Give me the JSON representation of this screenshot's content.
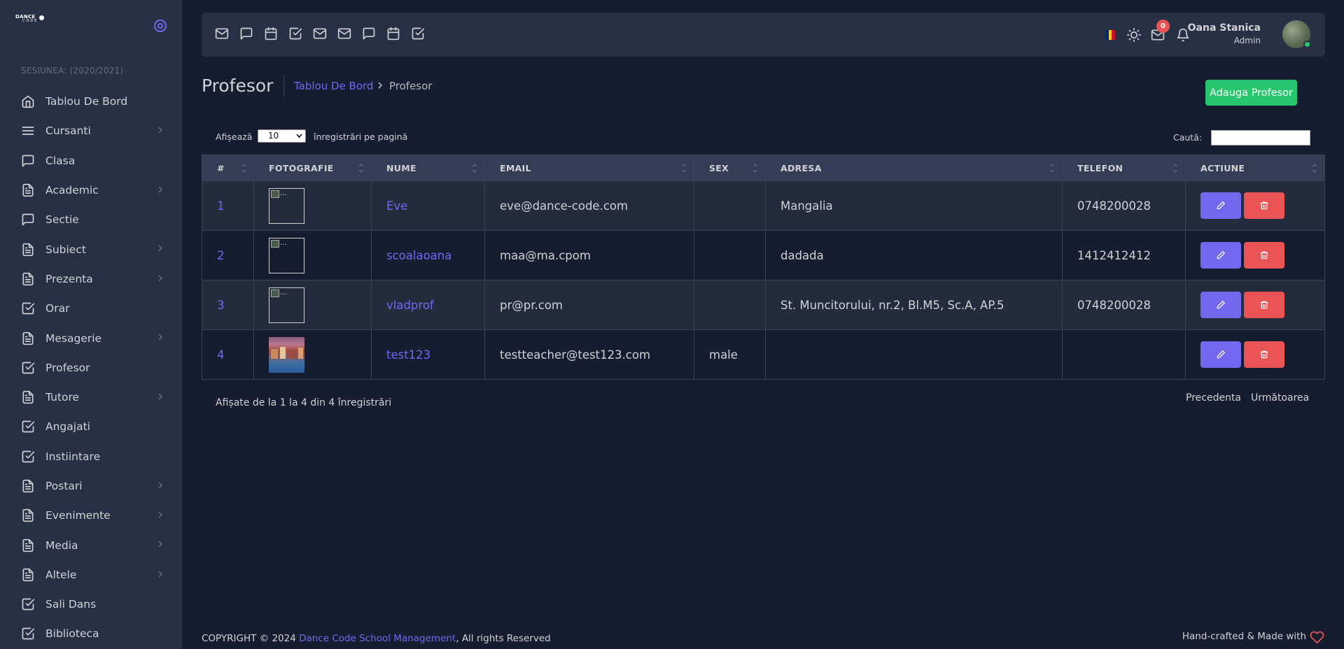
{
  "brand": {
    "logo_top": "DANCE",
    "logo_bottom": "CODE"
  },
  "sidebar": {
    "session": "SESIUNEA: (2020/2021)",
    "items": [
      {
        "label": "Tablou De Bord",
        "icon": "home-icon",
        "has_sub": false
      },
      {
        "label": "Cursanti",
        "icon": "menu-icon",
        "has_sub": true
      },
      {
        "label": "Clasa",
        "icon": "chat-icon",
        "has_sub": false
      },
      {
        "label": "Academic",
        "icon": "file-icon",
        "has_sub": true
      },
      {
        "label": "Sectie",
        "icon": "chat-icon",
        "has_sub": false
      },
      {
        "label": "Subiect",
        "icon": "file-icon",
        "has_sub": true
      },
      {
        "label": "Prezenta",
        "icon": "file-icon",
        "has_sub": true
      },
      {
        "label": "Orar",
        "icon": "check-square-icon",
        "has_sub": false
      },
      {
        "label": "Mesagerie",
        "icon": "file-icon",
        "has_sub": true
      },
      {
        "label": "Profesor",
        "icon": "check-square-icon",
        "has_sub": false
      },
      {
        "label": "Tutore",
        "icon": "file-icon",
        "has_sub": true
      },
      {
        "label": "Angajati",
        "icon": "check-square-icon",
        "has_sub": false
      },
      {
        "label": "Instiintare",
        "icon": "check-square-icon",
        "has_sub": false
      },
      {
        "label": "Postari",
        "icon": "file-icon",
        "has_sub": true
      },
      {
        "label": "Evenimente",
        "icon": "file-icon",
        "has_sub": true
      },
      {
        "label": "Media",
        "icon": "file-icon",
        "has_sub": true
      },
      {
        "label": "Altele",
        "icon": "file-icon",
        "has_sub": true
      },
      {
        "label": "Sali Dans",
        "icon": "check-square-icon",
        "has_sub": false
      },
      {
        "label": "Biblioteca",
        "icon": "check-square-icon",
        "has_sub": false
      }
    ]
  },
  "navbar": {
    "shortcuts": [
      "mail-icon",
      "chat-icon",
      "calendar-icon",
      "check-square-icon",
      "mail-icon",
      "mail-icon",
      "chat-icon",
      "calendar-icon",
      "check-square-icon"
    ],
    "mail_badge": "0",
    "user_name": "Oana Stanica",
    "user_role": "Admin"
  },
  "header": {
    "title": "Profesor",
    "breadcrumb_link": "Tablou De Bord",
    "breadcrumb_current": "Profesor",
    "add_button": "Adauga Profesor"
  },
  "table_controls": {
    "show_label": "Afișează",
    "page_length": "10",
    "suffix": "înregistrări pe pagină",
    "search_label": "Caută:"
  },
  "table": {
    "headers": [
      "#",
      "FOTOGRAFIE",
      "NUME",
      "EMAIL",
      "SEX",
      "ADRESA",
      "TELEFON",
      "ACTIUNE"
    ],
    "rows": [
      {
        "id": "1",
        "name": "Eve",
        "email": "eve@dance-code.com",
        "sex": "",
        "address": "Mangalia",
        "phone": "0748200028"
      },
      {
        "id": "2",
        "name": "scoalaoana",
        "email": "maa@ma.cpom",
        "sex": "",
        "address": "dadada",
        "phone": "1412412412"
      },
      {
        "id": "3",
        "name": "vladprof",
        "email": "pr@pr.com",
        "sex": "",
        "address": "St. Muncitorului, nr.2, Bl.M5, Sc.A, AP.5",
        "phone": "0748200028"
      },
      {
        "id": "4",
        "name": "test123",
        "email": "testteacher@test123.com",
        "sex": "male",
        "address": "",
        "phone": ""
      }
    ],
    "info": "Afișate de la 1 la 4 din 4 înregistrări",
    "prev": "Precedenta",
    "next": "Următoarea"
  },
  "footer": {
    "copyright_prefix": "COPYRIGHT © 2024 ",
    "copyright_link": "Dance Code School Management",
    "copyright_suffix": ", All rights Reserved",
    "right_text": "Hand-crafted & Made with"
  },
  "colors": {
    "primary": "#7367f0",
    "success": "#28c76f",
    "danger": "#ea5455",
    "bg": "#161d31",
    "card": "#283046"
  }
}
